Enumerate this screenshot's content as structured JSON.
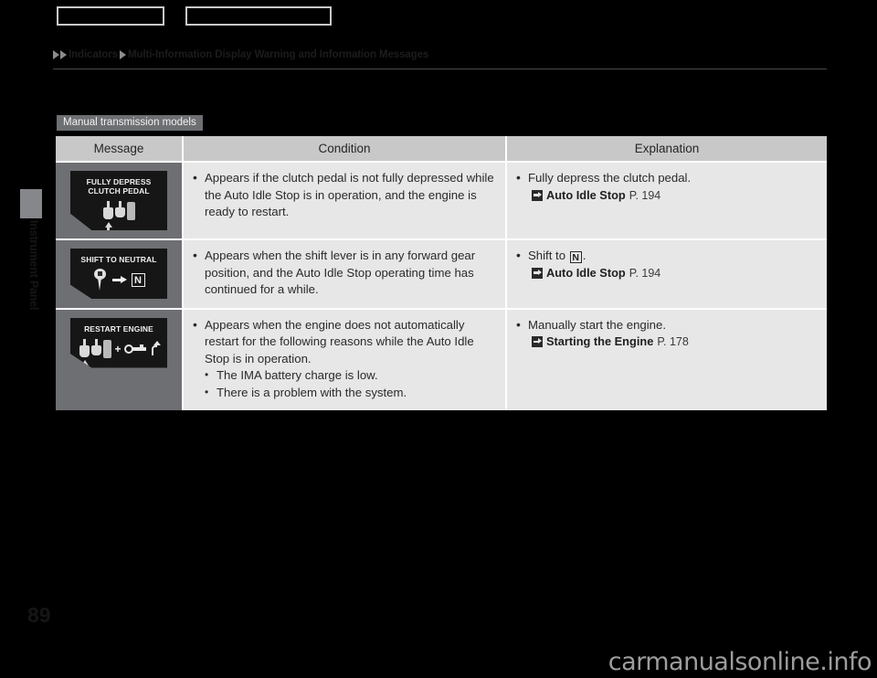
{
  "top_nav": {
    "buttons": [
      {
        "name": "nav-box-left",
        "label": ""
      },
      {
        "name": "nav-box-right",
        "label": ""
      }
    ]
  },
  "breadcrumb": {
    "items": [
      "Indicators",
      "Multi-Information Display Warning and Information Messages"
    ]
  },
  "side_tab": {
    "label": "Instrument Panel"
  },
  "page_number": "89",
  "section": {
    "chip_label": "Manual transmission models"
  },
  "table": {
    "headers": {
      "message": "Message",
      "condition": "Condition",
      "explanation": "Explanation"
    },
    "rows": [
      {
        "display": {
          "title": "FULLY DEPRESS\nCLUTCH PEDAL",
          "icons": [
            "clutch-pedal-pressed-icon",
            "brake-pedal-icon",
            "accelerator-pedal-icon"
          ]
        },
        "condition": [
          "Appears if the clutch pedal is not fully depressed while the Auto Idle Stop is in operation, and the engine is ready to restart."
        ],
        "explanation": {
          "bullet": "Fully depress the clutch pedal.",
          "xref_title": "Auto Idle Stop",
          "xref_page": "P. 194"
        }
      },
      {
        "display": {
          "title": "SHIFT TO NEUTRAL",
          "icons": [
            "shift-lever-icon",
            "right-arrow-icon",
            "neutral-n-icon"
          ]
        },
        "condition": [
          "Appears when the shift lever is in any forward gear position, and the Auto Idle Stop operating time has continued for a while."
        ],
        "explanation": {
          "bullet_prefix": "Shift to ",
          "bullet_badge": "N",
          "bullet_suffix": ".",
          "xref_title": "Auto Idle Stop",
          "xref_page": "P. 194"
        }
      },
      {
        "display": {
          "title": "RESTART ENGINE",
          "icons": [
            "clutch-pedal-pressed-icon",
            "brake-pedal-icon",
            "accelerator-pedal-icon",
            "plus-sign",
            "ignition-key-turn-icon"
          ]
        },
        "condition": [
          "Appears when the engine does not automatically restart for the following reasons while the Auto Idle Stop is in operation."
        ],
        "condition_sub": [
          "The IMA battery charge is low.",
          "There is a problem with the system."
        ],
        "explanation": {
          "bullet": "Manually start the engine.",
          "xref_title": "Starting the Engine",
          "xref_page": "P. 178"
        }
      }
    ]
  },
  "watermark": {
    "text": "carmanualsonline.info"
  },
  "colors": {
    "page_background": "#000000",
    "cell_background": "#e7e7e7",
    "header_background": "#c8c8c8",
    "message_cell_background": "#6d6f72",
    "chip_background": "#6d6f72",
    "lcd_background": "#161616"
  }
}
